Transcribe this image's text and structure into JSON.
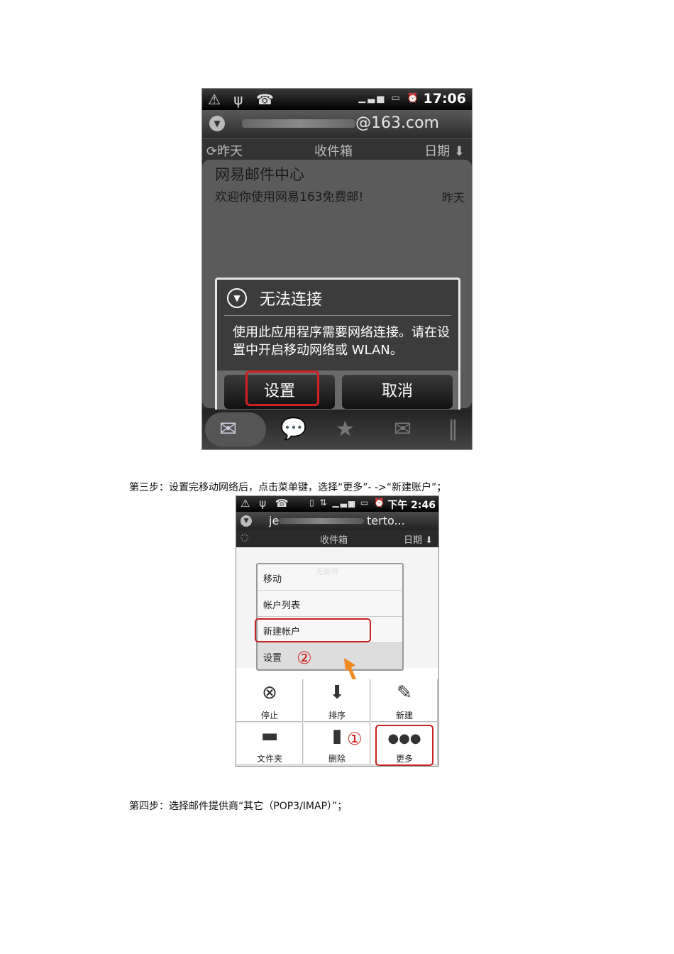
{
  "shot1": {
    "status": {
      "icons": "⚠ ψ ☎",
      "signal": "▁▃▅ ▭ ⏰",
      "time": "17:06"
    },
    "account": {
      "icon": "chevron-down-icon",
      "email_suffix": "@163.com"
    },
    "tabs": {
      "left": "⟳昨天",
      "center": "收件箱",
      "right": "日期 ⬇"
    },
    "message": {
      "sender": "网易邮件中心",
      "preview": "欢迎你使用网易163免费邮!",
      "date": "昨天"
    },
    "dialog": {
      "icon": "▼",
      "title": "无法连接",
      "body": "使用此应用程序需要网络连接。请在设置中开启移动网络或 WLAN。",
      "settings_button": "设置",
      "cancel_button": "取消"
    },
    "bottom_icons": [
      "mail-icon",
      "chat-icon",
      "starred-mail-icon",
      "envelope-icon",
      "attachment-icon"
    ]
  },
  "step3": "第三步：设置完移动网络后，点击菜单键，选择“更多”- ->“新建账户”；",
  "shot2": {
    "status": {
      "icons": "⚠ ψ ☎",
      "mid": "▯ ⇅ ▁▃▅ ▭ ⏰",
      "time": "下午 2:46"
    },
    "account": {
      "prefix": "je",
      "suffix": "terto..."
    },
    "tabs": {
      "left": "◌",
      "center": "收件箱",
      "right": "日期 ⬇"
    },
    "menu": {
      "ghost": "无邮件",
      "items": [
        "移动",
        "帐户列表",
        "新建帐户",
        "设置"
      ]
    },
    "marker2": "②",
    "marker1": "①",
    "grid": [
      {
        "icon": "⊗",
        "label": "停止"
      },
      {
        "icon": "⬇",
        "label": "排序"
      },
      {
        "icon": "✎",
        "label": "新建"
      },
      {
        "icon": "▬",
        "label": "文件夹"
      },
      {
        "icon": "▮",
        "label": "删除"
      },
      {
        "icon": "●●●",
        "label": "更多"
      }
    ]
  },
  "step4": "第四步：选择邮件提供商“其它（POP3/IMAP）”；"
}
